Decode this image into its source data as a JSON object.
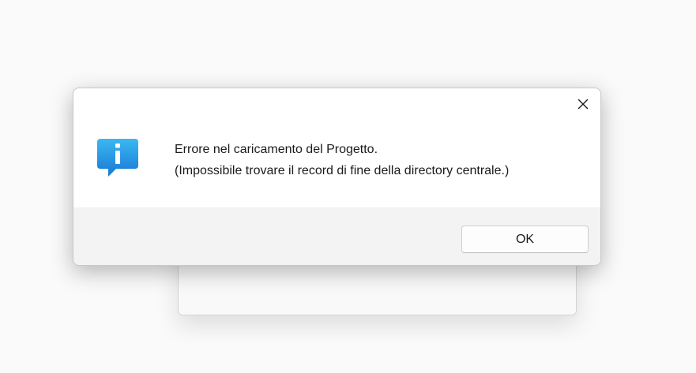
{
  "dialog": {
    "message_line1": "Errore nel caricamento del Progetto.",
    "message_line2": "(Impossibile trovare il record di fine della directory centrale.)",
    "ok_label": "OK",
    "icon": "info-icon",
    "close_icon": "close-icon"
  },
  "colors": {
    "info_icon_top": "#39b4f0",
    "info_icon_bottom": "#1a78d6",
    "footer_bg": "#f3f3f3",
    "page_bg": "#fafafa"
  }
}
